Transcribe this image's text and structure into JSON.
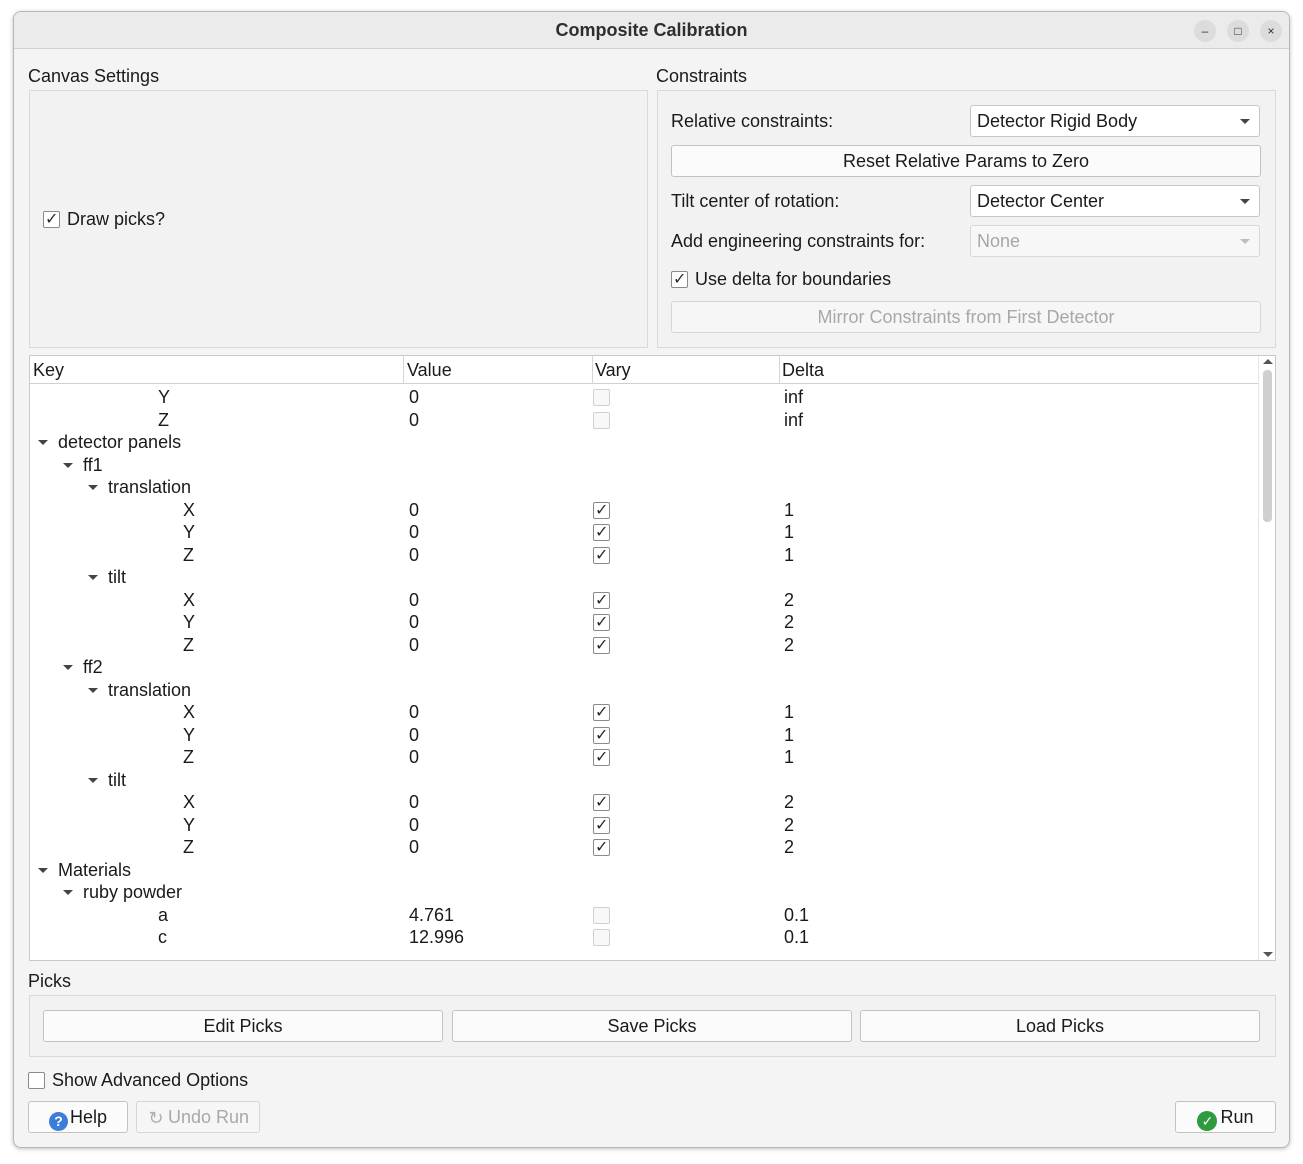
{
  "window": {
    "title": "Composite Calibration",
    "controls": {
      "minimize": "–",
      "maximize": "□",
      "close": "×"
    }
  },
  "canvas_settings": {
    "label": "Canvas Settings",
    "draw_picks_label": "Draw picks?",
    "draw_picks_checked": true
  },
  "constraints": {
    "label": "Constraints",
    "relative_label": "Relative constraints:",
    "relative_value": "Detector Rigid Body",
    "reset_button": "Reset Relative Params to Zero",
    "tilt_label": "Tilt center of rotation:",
    "tilt_value": "Detector Center",
    "engineering_label": "Add engineering constraints for:",
    "engineering_value": "None",
    "use_delta_label": "Use delta for boundaries",
    "use_delta_checked": true,
    "mirror_button": "Mirror Constraints from First Detector"
  },
  "tree": {
    "headers": {
      "key": "Key",
      "value": "Value",
      "vary": "Vary",
      "delta": "Delta"
    },
    "rows": [
      {
        "key": "Y",
        "level": 3,
        "value": "0",
        "vary": false,
        "delta": "inf",
        "expandable": false
      },
      {
        "key": "Z",
        "level": 3,
        "value": "0",
        "vary": false,
        "delta": "inf",
        "expandable": false
      },
      {
        "key": "detector panels",
        "level": 0,
        "value": "",
        "vary": null,
        "delta": "",
        "expandable": true
      },
      {
        "key": "ff1",
        "level": 1,
        "value": "",
        "vary": null,
        "delta": "",
        "expandable": true
      },
      {
        "key": "translation",
        "level": 2,
        "value": "",
        "vary": null,
        "delta": "",
        "expandable": true
      },
      {
        "key": "X",
        "level": 4,
        "value": "0",
        "vary": true,
        "delta": "1",
        "expandable": false
      },
      {
        "key": "Y",
        "level": 4,
        "value": "0",
        "vary": true,
        "delta": "1",
        "expandable": false
      },
      {
        "key": "Z",
        "level": 4,
        "value": "0",
        "vary": true,
        "delta": "1",
        "expandable": false
      },
      {
        "key": "tilt",
        "level": 2,
        "value": "",
        "vary": null,
        "delta": "",
        "expandable": true
      },
      {
        "key": "X",
        "level": 4,
        "value": "0",
        "vary": true,
        "delta": "2",
        "expandable": false
      },
      {
        "key": "Y",
        "level": 4,
        "value": "0",
        "vary": true,
        "delta": "2",
        "expandable": false
      },
      {
        "key": "Z",
        "level": 4,
        "value": "0",
        "vary": true,
        "delta": "2",
        "expandable": false
      },
      {
        "key": "ff2",
        "level": 1,
        "value": "",
        "vary": null,
        "delta": "",
        "expandable": true
      },
      {
        "key": "translation",
        "level": 2,
        "value": "",
        "vary": null,
        "delta": "",
        "expandable": true
      },
      {
        "key": "X",
        "level": 4,
        "value": "0",
        "vary": true,
        "delta": "1",
        "expandable": false
      },
      {
        "key": "Y",
        "level": 4,
        "value": "0",
        "vary": true,
        "delta": "1",
        "expandable": false
      },
      {
        "key": "Z",
        "level": 4,
        "value": "0",
        "vary": true,
        "delta": "1",
        "expandable": false
      },
      {
        "key": "tilt",
        "level": 2,
        "value": "",
        "vary": null,
        "delta": "",
        "expandable": true
      },
      {
        "key": "X",
        "level": 4,
        "value": "0",
        "vary": true,
        "delta": "2",
        "expandable": false
      },
      {
        "key": "Y",
        "level": 4,
        "value": "0",
        "vary": true,
        "delta": "2",
        "expandable": false
      },
      {
        "key": "Z",
        "level": 4,
        "value": "0",
        "vary": true,
        "delta": "2",
        "expandable": false
      },
      {
        "key": "Materials",
        "level": 0,
        "value": "",
        "vary": null,
        "delta": "",
        "expandable": true
      },
      {
        "key": "ruby powder",
        "level": 1,
        "value": "",
        "vary": null,
        "delta": "",
        "expandable": true
      },
      {
        "key": "a",
        "level": 3,
        "value": "4.761",
        "vary": false,
        "delta": "0.1",
        "expandable": false
      },
      {
        "key": "c",
        "level": 3,
        "value": "12.996",
        "vary": false,
        "delta": "0.1",
        "expandable": false
      }
    ]
  },
  "picks": {
    "label": "Picks",
    "edit_button": "Edit Picks",
    "save_button": "Save Picks",
    "load_button": "Load Picks"
  },
  "advanced": {
    "label": "Show Advanced Options",
    "checked": false
  },
  "footer": {
    "help_button": "Help",
    "undo_button": "Undo Run",
    "run_button": "Run"
  }
}
